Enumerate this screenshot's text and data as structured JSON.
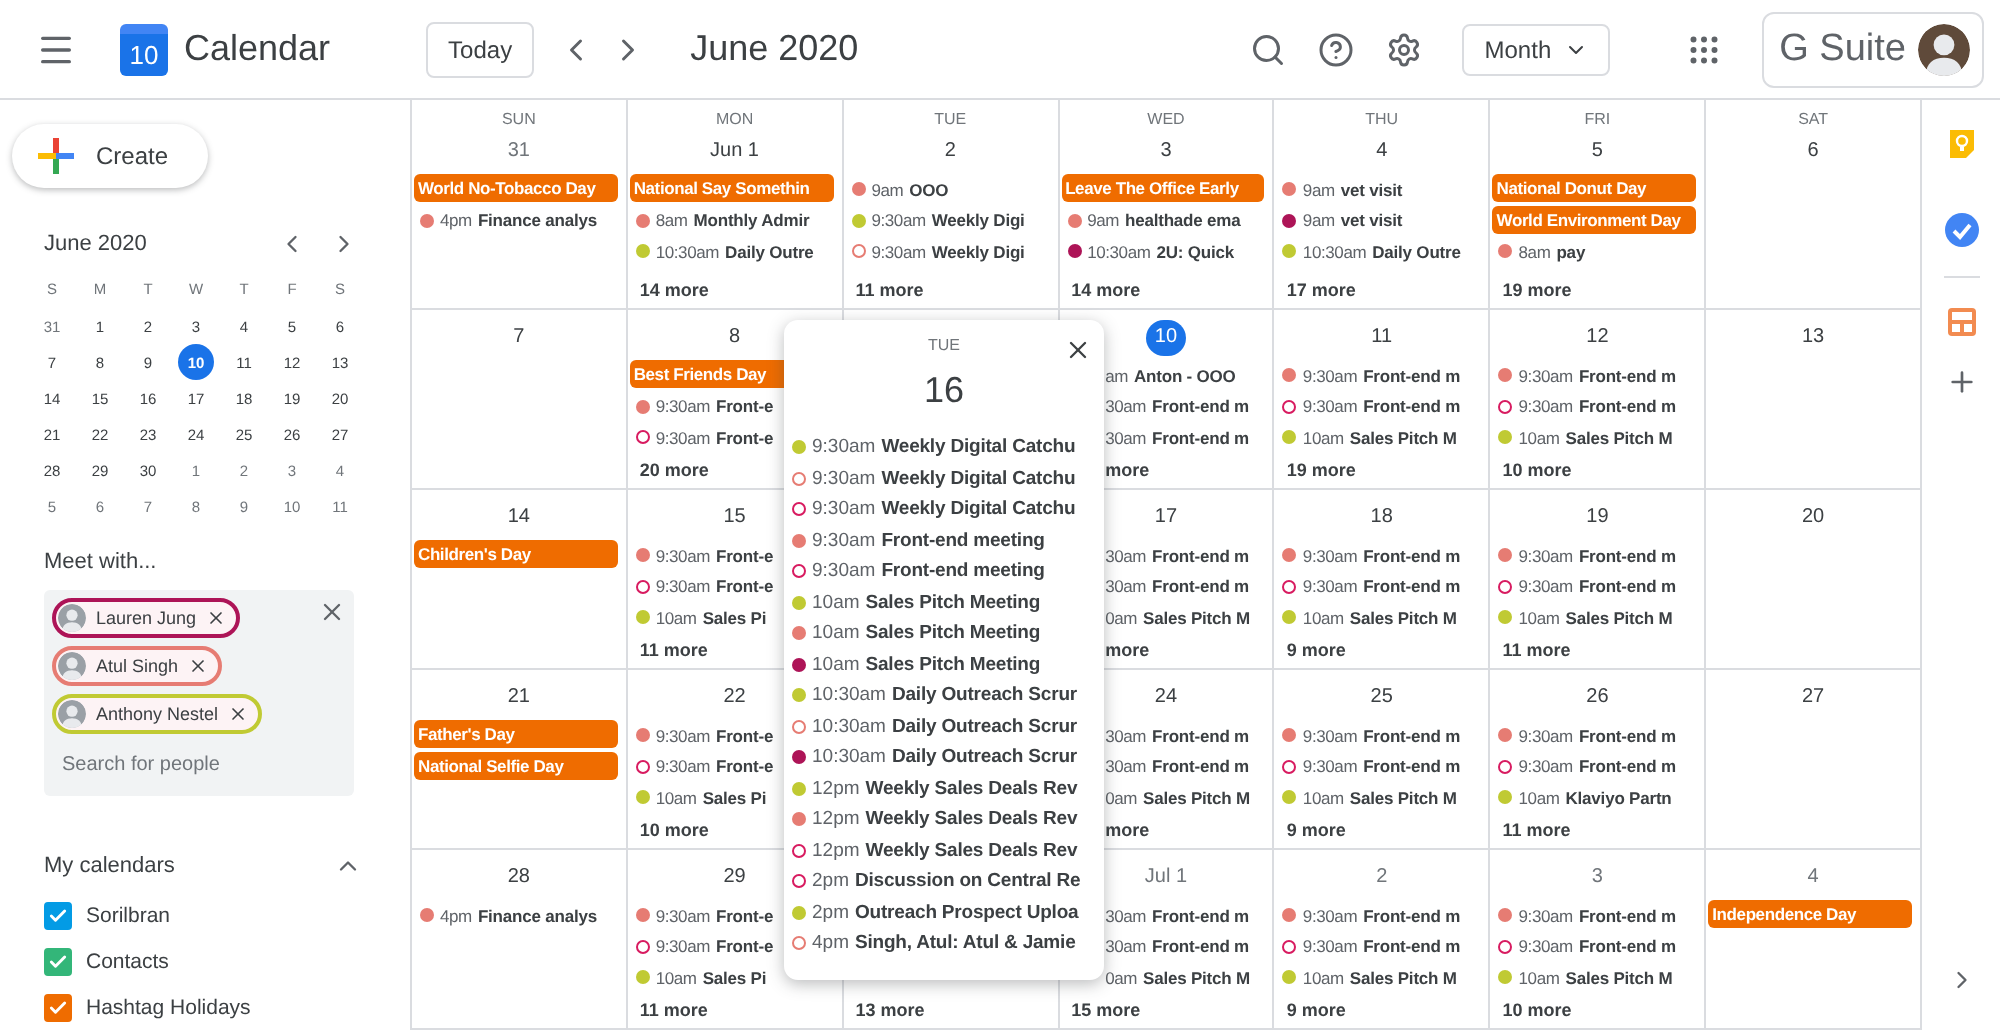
{
  "header": {
    "logo_day": "10",
    "app_title": "Calendar",
    "today_button": "Today",
    "period": "June 2020",
    "view": "Month",
    "brand": "G Suite"
  },
  "sidebar": {
    "create": "Create",
    "mini_calendar": {
      "title": "June 2020",
      "weekdays": [
        "S",
        "M",
        "T",
        "W",
        "T",
        "F",
        "S"
      ],
      "days": [
        {
          "d": "31",
          "other": true,
          "today": false
        },
        {
          "d": "1",
          "other": false,
          "today": false
        },
        {
          "d": "2",
          "other": false,
          "today": false
        },
        {
          "d": "3",
          "other": false,
          "today": false
        },
        {
          "d": "4",
          "other": false,
          "today": false
        },
        {
          "d": "5",
          "other": false,
          "today": false
        },
        {
          "d": "6",
          "other": false,
          "today": false
        },
        {
          "d": "7",
          "other": false,
          "today": false
        },
        {
          "d": "8",
          "other": false,
          "today": false
        },
        {
          "d": "9",
          "other": false,
          "today": false
        },
        {
          "d": "10",
          "other": false,
          "today": true
        },
        {
          "d": "11",
          "other": false,
          "today": false
        },
        {
          "d": "12",
          "other": false,
          "today": false
        },
        {
          "d": "13",
          "other": false,
          "today": false
        },
        {
          "d": "14",
          "other": false,
          "today": false
        },
        {
          "d": "15",
          "other": false,
          "today": false
        },
        {
          "d": "16",
          "other": false,
          "today": false
        },
        {
          "d": "17",
          "other": false,
          "today": false
        },
        {
          "d": "18",
          "other": false,
          "today": false
        },
        {
          "d": "19",
          "other": false,
          "today": false
        },
        {
          "d": "20",
          "other": false,
          "today": false
        },
        {
          "d": "21",
          "other": false,
          "today": false
        },
        {
          "d": "22",
          "other": false,
          "today": false
        },
        {
          "d": "23",
          "other": false,
          "today": false
        },
        {
          "d": "24",
          "other": false,
          "today": false
        },
        {
          "d": "25",
          "other": false,
          "today": false
        },
        {
          "d": "26",
          "other": false,
          "today": false
        },
        {
          "d": "27",
          "other": false,
          "today": false
        },
        {
          "d": "28",
          "other": false,
          "today": false
        },
        {
          "d": "29",
          "other": false,
          "today": false
        },
        {
          "d": "30",
          "other": false,
          "today": false
        },
        {
          "d": "1",
          "other": true,
          "today": false
        },
        {
          "d": "2",
          "other": true,
          "today": false
        },
        {
          "d": "3",
          "other": true,
          "today": false
        },
        {
          "d": "4",
          "other": true,
          "today": false
        },
        {
          "d": "5",
          "other": true,
          "today": false
        },
        {
          "d": "6",
          "other": true,
          "today": false
        },
        {
          "d": "7",
          "other": true,
          "today": false
        },
        {
          "d": "8",
          "other": true,
          "today": false
        },
        {
          "d": "9",
          "other": true,
          "today": false
        },
        {
          "d": "10",
          "other": true,
          "today": false
        },
        {
          "d": "11",
          "other": true,
          "today": false
        }
      ]
    },
    "meet_with": {
      "title": "Meet with...",
      "people": [
        {
          "name": "Lauren Jung",
          "color": "#ad1457"
        },
        {
          "name": "Atul Singh",
          "color": "#e67c73"
        },
        {
          "name": "Anthony Nestel",
          "color": "#c0ca33"
        }
      ],
      "placeholder": "Search for people"
    },
    "my_calendars": {
      "title": "My calendars",
      "expanded": true,
      "items": [
        {
          "label": "Sorilbran",
          "checked": true,
          "color": "#039be5"
        },
        {
          "label": "Contacts",
          "checked": true,
          "color": "#33b679"
        },
        {
          "label": "Hashtag Holidays",
          "checked": true,
          "color": "#ef6c00"
        }
      ]
    }
  },
  "month": {
    "weekdays": [
      "SUN",
      "MON",
      "TUE",
      "WED",
      "THU",
      "FRI",
      "SAT"
    ],
    "weeks": [
      {
        "sun": {
          "date": "31",
          "today": false,
          "other": true,
          "chips": [
            "World No-Tobacco Day"
          ],
          "events": [
            {
              "hollow": false,
              "color": "#e67c73",
              "time": "4pm",
              "title": "Finance analys"
            }
          ]
        },
        "mon": {
          "date": "Jun 1",
          "today": false,
          "other": false,
          "chips": [
            "National Say Somethin"
          ],
          "events": [
            {
              "hollow": false,
              "color": "#e67c73",
              "time": "8am",
              "title": "Monthly Admir"
            },
            {
              "hollow": false,
              "color": "#c0ca33",
              "time": "10:30am",
              "title": "Daily Outre"
            }
          ],
          "more": "14 more"
        },
        "tue": {
          "date": "2",
          "today": false,
          "other": false,
          "events": [
            {
              "hollow": false,
              "color": "#e67c73",
              "time": "9am",
              "title": "OOO"
            },
            {
              "hollow": false,
              "color": "#c0ca33",
              "time": "9:30am",
              "title": "Weekly Digi"
            },
            {
              "hollow": true,
              "color": "#e67c73",
              "time": "9:30am",
              "title": "Weekly Digi"
            }
          ],
          "more": "11 more"
        },
        "wed": {
          "date": "3",
          "today": false,
          "other": false,
          "chips": [
            "Leave The Office Early"
          ],
          "events": [
            {
              "hollow": false,
              "color": "#e67c73",
              "time": "9am",
              "title": "healthade ema"
            },
            {
              "hollow": false,
              "color": "#ad1457",
              "time": "10:30am",
              "title": "2U: Quick"
            }
          ],
          "more": "14 more"
        },
        "thu": {
          "date": "4",
          "today": false,
          "other": false,
          "events": [
            {
              "hollow": false,
              "color": "#e67c73",
              "time": "9am",
              "title": "vet visit"
            },
            {
              "hollow": false,
              "color": "#ad1457",
              "time": "9am",
              "title": "vet visit"
            },
            {
              "hollow": false,
              "color": "#c0ca33",
              "time": "10:30am",
              "title": "Daily Outre"
            }
          ],
          "more": "17 more"
        },
        "fri": {
          "date": "5",
          "today": false,
          "other": false,
          "chips": [
            "National Donut Day",
            "World Environment Day"
          ],
          "events": [
            {
              "hollow": false,
              "color": "#e67c73",
              "time": "8am",
              "title": "pay"
            }
          ],
          "more": "19 more"
        },
        "sat": {
          "date": "6",
          "today": false,
          "other": false
        }
      },
      {
        "sun": {
          "date": "7",
          "today": false,
          "other": false
        },
        "mon": {
          "date": "8",
          "today": false,
          "other": false,
          "chips": [
            "Best Friends Day"
          ],
          "events": [
            {
              "hollow": false,
              "color": "#e67c73",
              "time": "9:30am",
              "title": "Front-e"
            },
            {
              "hollow": true,
              "color": "#d81b60",
              "time": "9:30am",
              "title": "Front-e"
            }
          ],
          "more": "20 more"
        },
        "wed": {
          "date": "10",
          "today": true,
          "other": false,
          "events": [
            {
              "time": "am",
              "title": "Anton - OOO"
            },
            {
              "time": "30am",
              "title": "Front-end m"
            },
            {
              "time": "30am",
              "title": "Front-end m"
            }
          ],
          "more": "more"
        },
        "thu": {
          "date": "11",
          "today": false,
          "other": false,
          "events": [
            {
              "hollow": false,
              "color": "#e67c73",
              "time": "9:30am",
              "title": "Front-end m"
            },
            {
              "hollow": true,
              "color": "#d81b60",
              "time": "9:30am",
              "title": "Front-end m"
            },
            {
              "hollow": false,
              "color": "#c0ca33",
              "time": "10am",
              "title": "Sales Pitch M"
            }
          ],
          "more": "19 more"
        },
        "fri": {
          "date": "12",
          "today": false,
          "other": false,
          "events": [
            {
              "hollow": false,
              "color": "#e67c73",
              "time": "9:30am",
              "title": "Front-end m"
            },
            {
              "hollow": true,
              "color": "#d81b60",
              "time": "9:30am",
              "title": "Front-end m"
            },
            {
              "hollow": false,
              "color": "#c0ca33",
              "time": "10am",
              "title": "Sales Pitch M"
            }
          ],
          "more": "10 more"
        },
        "sat": {
          "date": "13",
          "today": false,
          "other": false
        }
      },
      {
        "sun": {
          "date": "14",
          "today": false,
          "other": false,
          "chips": [
            "Children's Day"
          ]
        },
        "mon": {
          "date": "15",
          "today": false,
          "other": false,
          "events": [
            {
              "hollow": false,
              "color": "#e67c73",
              "time": "9:30am",
              "title": "Front-e"
            },
            {
              "hollow": true,
              "color": "#d81b60",
              "time": "9:30am",
              "title": "Front-e"
            },
            {
              "hollow": false,
              "color": "#c0ca33",
              "time": "10am",
              "title": "Sales Pi"
            }
          ],
          "more": "11 more"
        },
        "wed": {
          "date": "17",
          "today": false,
          "other": false,
          "events": [
            {
              "time": "30am",
              "title": "Front-end m"
            },
            {
              "time": "30am",
              "title": "Front-end m"
            },
            {
              "time": "0am",
              "title": "Sales Pitch M"
            }
          ],
          "more": "more"
        },
        "thu": {
          "date": "18",
          "today": false,
          "other": false,
          "events": [
            {
              "hollow": false,
              "color": "#e67c73",
              "time": "9:30am",
              "title": "Front-end m"
            },
            {
              "hollow": true,
              "color": "#d81b60",
              "time": "9:30am",
              "title": "Front-end m"
            },
            {
              "hollow": false,
              "color": "#c0ca33",
              "time": "10am",
              "title": "Sales Pitch M"
            }
          ],
          "more": "9 more"
        },
        "fri": {
          "date": "19",
          "today": false,
          "other": false,
          "events": [
            {
              "hollow": false,
              "color": "#e67c73",
              "time": "9:30am",
              "title": "Front-end m"
            },
            {
              "hollow": true,
              "color": "#d81b60",
              "time": "9:30am",
              "title": "Front-end m"
            },
            {
              "hollow": false,
              "color": "#c0ca33",
              "time": "10am",
              "title": "Sales Pitch M"
            }
          ],
          "more": "11 more"
        },
        "sat": {
          "date": "20",
          "today": false,
          "other": false
        }
      },
      {
        "sun": {
          "date": "21",
          "today": false,
          "other": false,
          "chips": [
            "Father's Day",
            "National Selfie Day"
          ]
        },
        "mon": {
          "date": "22",
          "today": false,
          "other": false,
          "events": [
            {
              "hollow": false,
              "color": "#e67c73",
              "time": "9:30am",
              "title": "Front-e"
            },
            {
              "hollow": true,
              "color": "#d81b60",
              "time": "9:30am",
              "title": "Front-e"
            },
            {
              "hollow": false,
              "color": "#c0ca33",
              "time": "10am",
              "title": "Sales Pi"
            }
          ],
          "more": "10 more"
        },
        "wed": {
          "date": "24",
          "today": false,
          "other": false,
          "events": [
            {
              "time": "30am",
              "title": "Front-end m"
            },
            {
              "time": "30am",
              "title": "Front-end m"
            },
            {
              "time": "0am",
              "title": "Sales Pitch M"
            }
          ],
          "more": "more"
        },
        "thu": {
          "date": "25",
          "today": false,
          "other": false,
          "events": [
            {
              "hollow": false,
              "color": "#e67c73",
              "time": "9:30am",
              "title": "Front-end m"
            },
            {
              "hollow": true,
              "color": "#d81b60",
              "time": "9:30am",
              "title": "Front-end m"
            },
            {
              "hollow": false,
              "color": "#c0ca33",
              "time": "10am",
              "title": "Sales Pitch M"
            }
          ],
          "more": "9 more"
        },
        "fri": {
          "date": "26",
          "today": false,
          "other": false,
          "events": [
            {
              "hollow": false,
              "color": "#e67c73",
              "time": "9:30am",
              "title": "Front-end m"
            },
            {
              "hollow": true,
              "color": "#d81b60",
              "time": "9:30am",
              "title": "Front-end m"
            },
            {
              "hollow": false,
              "color": "#c0ca33",
              "time": "10am",
              "title": "Klaviyo Partn"
            }
          ],
          "more": "11 more"
        },
        "sat": {
          "date": "27",
          "today": false,
          "other": false
        }
      },
      {
        "sun": {
          "date": "28",
          "today": false,
          "other": false,
          "events": [
            {
              "hollow": false,
              "color": "#e67c73",
              "time": "4pm",
              "title": "Finance analys"
            }
          ]
        },
        "mon": {
          "date": "29",
          "today": false,
          "other": false,
          "events": [
            {
              "hollow": false,
              "color": "#e67c73",
              "time": "9:30am",
              "title": "Front-e"
            },
            {
              "hollow": true,
              "color": "#d81b60",
              "time": "9:30am",
              "title": "Front-e"
            },
            {
              "hollow": false,
              "color": "#c0ca33",
              "time": "10am",
              "title": "Sales Pi"
            }
          ],
          "more": "11 more"
        },
        "tue": {
          "more": "13 more"
        },
        "wed": {
          "date": "Jul 1",
          "today": false,
          "other": true,
          "events": [
            {
              "time": "30am",
              "title": "Front-end m"
            },
            {
              "time": "30am",
              "title": "Front-end m"
            },
            {
              "time": "0am",
              "title": "Sales Pitch M"
            }
          ],
          "more": "15 more"
        },
        "thu": {
          "date": "2",
          "today": false,
          "other": true,
          "events": [
            {
              "hollow": false,
              "color": "#e67c73",
              "time": "9:30am",
              "title": "Front-end m"
            },
            {
              "hollow": true,
              "color": "#d81b60",
              "time": "9:30am",
              "title": "Front-end m"
            },
            {
              "hollow": false,
              "color": "#c0ca33",
              "time": "10am",
              "title": "Sales Pitch M"
            }
          ],
          "more": "9 more"
        },
        "fri": {
          "date": "3",
          "today": false,
          "other": true,
          "events": [
            {
              "hollow": false,
              "color": "#e67c73",
              "time": "9:30am",
              "title": "Front-end m"
            },
            {
              "hollow": true,
              "color": "#d81b60",
              "time": "9:30am",
              "title": "Front-end m"
            },
            {
              "hollow": false,
              "color": "#c0ca33",
              "time": "10am",
              "title": "Sales Pitch M"
            }
          ],
          "more": "10 more"
        },
        "sat": {
          "date": "4",
          "today": false,
          "other": true,
          "chips": [
            "Independence Day"
          ]
        }
      }
    ]
  },
  "popup": {
    "weekday": "TUE",
    "date": "16",
    "events": [
      {
        "hollow": false,
        "color": "#c0ca33",
        "time": "9:30am",
        "title": "Weekly Digital Catchu"
      },
      {
        "hollow": true,
        "color": "#e67c73",
        "time": "9:30am",
        "title": "Weekly Digital Catchu"
      },
      {
        "hollow": true,
        "color": "#d81b60",
        "time": "9:30am",
        "title": "Weekly Digital Catchu"
      },
      {
        "hollow": false,
        "color": "#e67c73",
        "time": "9:30am",
        "title": "Front-end meeting"
      },
      {
        "hollow": true,
        "color": "#d81b60",
        "time": "9:30am",
        "title": "Front-end meeting"
      },
      {
        "hollow": false,
        "color": "#c0ca33",
        "time": "10am",
        "title": "Sales Pitch Meeting"
      },
      {
        "hollow": false,
        "color": "#e67c73",
        "time": "10am",
        "title": "Sales Pitch Meeting"
      },
      {
        "hollow": false,
        "color": "#ad1457",
        "time": "10am",
        "title": "Sales Pitch Meeting"
      },
      {
        "hollow": false,
        "color": "#c0ca33",
        "time": "10:30am",
        "title": "Daily Outreach Scrur"
      },
      {
        "hollow": true,
        "color": "#e67c73",
        "time": "10:30am",
        "title": "Daily Outreach Scrur"
      },
      {
        "hollow": false,
        "color": "#ad1457",
        "time": "10:30am",
        "title": "Daily Outreach Scrur"
      },
      {
        "hollow": false,
        "color": "#c0ca33",
        "time": "12pm",
        "title": "Weekly Sales Deals Rev"
      },
      {
        "hollow": false,
        "color": "#e67c73",
        "time": "12pm",
        "title": "Weekly Sales Deals Rev"
      },
      {
        "hollow": true,
        "color": "#d81b60",
        "time": "12pm",
        "title": "Weekly Sales Deals Rev"
      },
      {
        "hollow": true,
        "color": "#d81b60",
        "time": "2pm",
        "title": "Discussion on Central Re"
      },
      {
        "hollow": false,
        "color": "#c0ca33",
        "time": "2pm",
        "title": "Outreach Prospect Uploa"
      },
      {
        "hollow": true,
        "color": "#e67c73",
        "time": "4pm",
        "title": "Singh, Atul: Atul & Jamie"
      }
    ]
  }
}
